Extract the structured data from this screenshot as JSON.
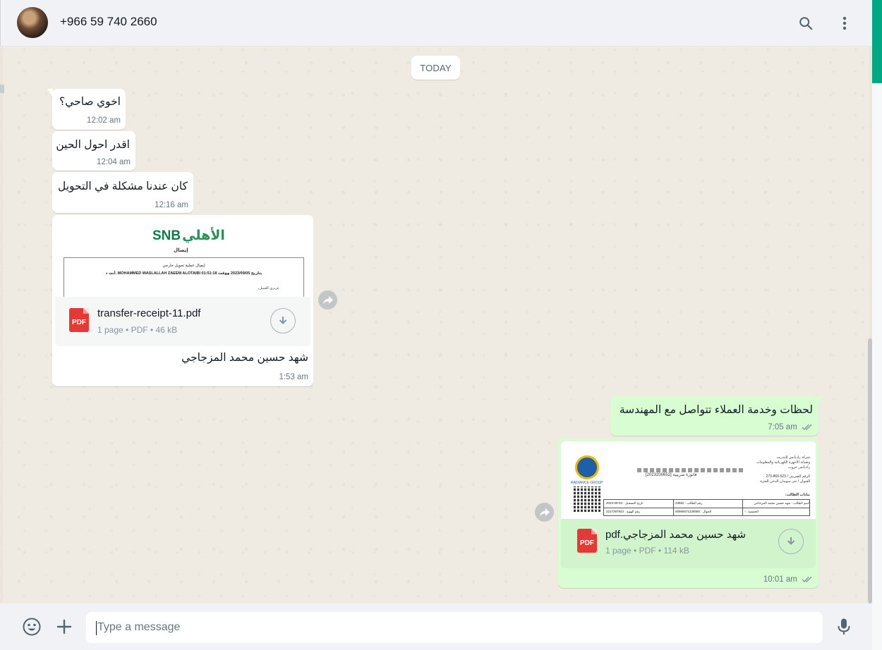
{
  "header": {
    "contact_name": "+966 59 740 2660",
    "search_icon": "search-icon",
    "menu_icon": "kebab-menu-icon"
  },
  "chat": {
    "day_divider": "TODAY",
    "messages": [
      {
        "direction": "in",
        "text": "اخوي صاحي؟",
        "time": "12:02 am"
      },
      {
        "direction": "in",
        "text": "اقدر احول الحين",
        "time": "12:04 am"
      },
      {
        "direction": "in",
        "text": "كان عندنا مشكلة في التحويل",
        "time": "12:16 am"
      },
      {
        "direction": "in",
        "type": "document",
        "preview": {
          "bank_logo_ar": "الأهلي",
          "bank_logo_en": "SNB",
          "receipt_title": "إيصال",
          "line1": "إيصال عملية تحويل خارجي",
          "line2": "أنت د. MOHAMMED WASLALLAH ZAEEM ALOTAIBI بتاريخ 2023/09/05 ووقت 01:51:18",
          "line3": "عزيزي العميل،"
        },
        "file_name": "transfer-receipt-11.pdf",
        "meta": "1 page • PDF • 46 kB",
        "caption": "شهد حسين محمد المزجاجي",
        "time": "1:53 am"
      },
      {
        "direction": "out",
        "text": "لحظات وخدمة العملاء تتواصل مع المهندسة",
        "time": "7:05 am",
        "status": "read"
      },
      {
        "direction": "out",
        "type": "document",
        "preview": {
          "company_ar": "شركة رادياتس للتدريب",
          "company_line2": "وصيانة الأجهزة الكهربائية والمعلومات",
          "company_line3": "رادياتس جروب",
          "cr_number": "الرقم الضريبي / 523-869-273",
          "address": "العنوان / حي سويدان الدخن العنزة",
          "invoice_title": "فاتورة ضريبية",
          "invoice_number": "2023200652",
          "student_section": "بيانات الطالب:",
          "row1_a": "تاريخ التسجيل : 03-09-2023",
          "row1_b": "رقم الطالب : 23652",
          "row1_c": "اسم الطالب : شهد حسين محمد المزجاجي",
          "row2_a": "رقم الهوية : 2217397843",
          "row2_b": "الجوال : 00966571228080",
          "row2_c": "الجنسية : -",
          "logo_caption": "RADIANCE GROUP"
        },
        "file_name": "شهد حسين محمد المزجاجي.pdf",
        "meta": "1 page • PDF • 114 kB",
        "time": "10:01 am",
        "status": "read"
      }
    ]
  },
  "composer": {
    "placeholder": "Type a message",
    "emoji_icon": "emoji-icon",
    "attach_icon": "plus-icon",
    "mic_icon": "microphone-icon"
  },
  "colors": {
    "incoming_bubble": "#ffffff",
    "outgoing_bubble": "#d9fdd3",
    "accent": "#00a884",
    "read_ticks": "#8696a0",
    "pdf_badge": "#e53935"
  }
}
